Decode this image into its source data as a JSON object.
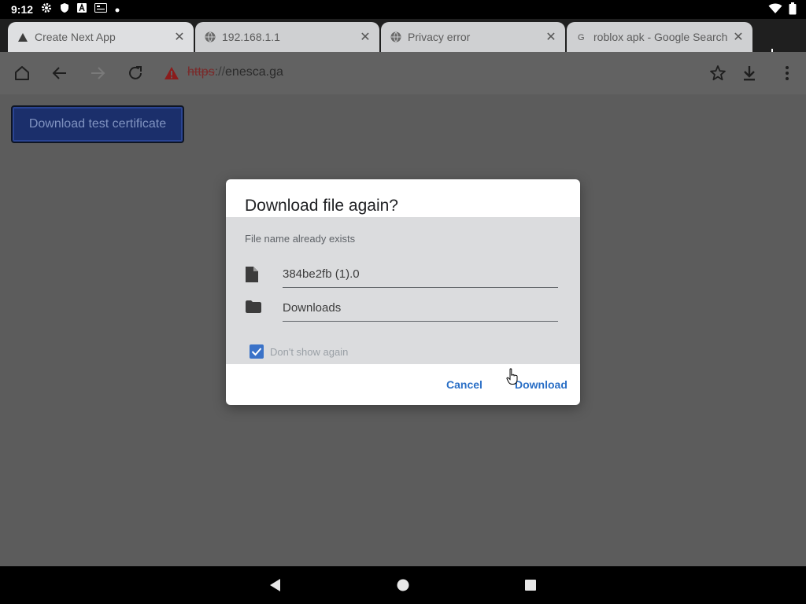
{
  "statusbar": {
    "time": "9:12",
    "icons": [
      "gear-icon",
      "shield-icon",
      "a-icon",
      "card-icon",
      "dot-icon"
    ],
    "right_icons": [
      "wifi-icon",
      "battery-icon"
    ]
  },
  "tabs": [
    {
      "title": "Create Next App",
      "favicon": "triangle-icon",
      "active": true
    },
    {
      "title": "192.168.1.1",
      "favicon": "globe-icon",
      "active": false
    },
    {
      "title": "Privacy error",
      "favicon": "globe-icon",
      "active": false
    },
    {
      "title": "roblox apk - Google Search",
      "favicon": "google-icon",
      "active": false
    }
  ],
  "toolbar": {
    "url_scheme": "https",
    "url_sep": "://",
    "url_host": "enesca.ga"
  },
  "page": {
    "download_cert_label": "Download test certificate"
  },
  "dialog": {
    "title": "Download file again?",
    "subtitle": "File name already exists",
    "file_name": "384be2fb (1).0",
    "folder": "Downloads",
    "checkbox_label": "Don't show again",
    "checkbox_checked": true,
    "cancel_label": "Cancel",
    "download_label": "Download",
    "accent_color": "#2a6fc6"
  }
}
